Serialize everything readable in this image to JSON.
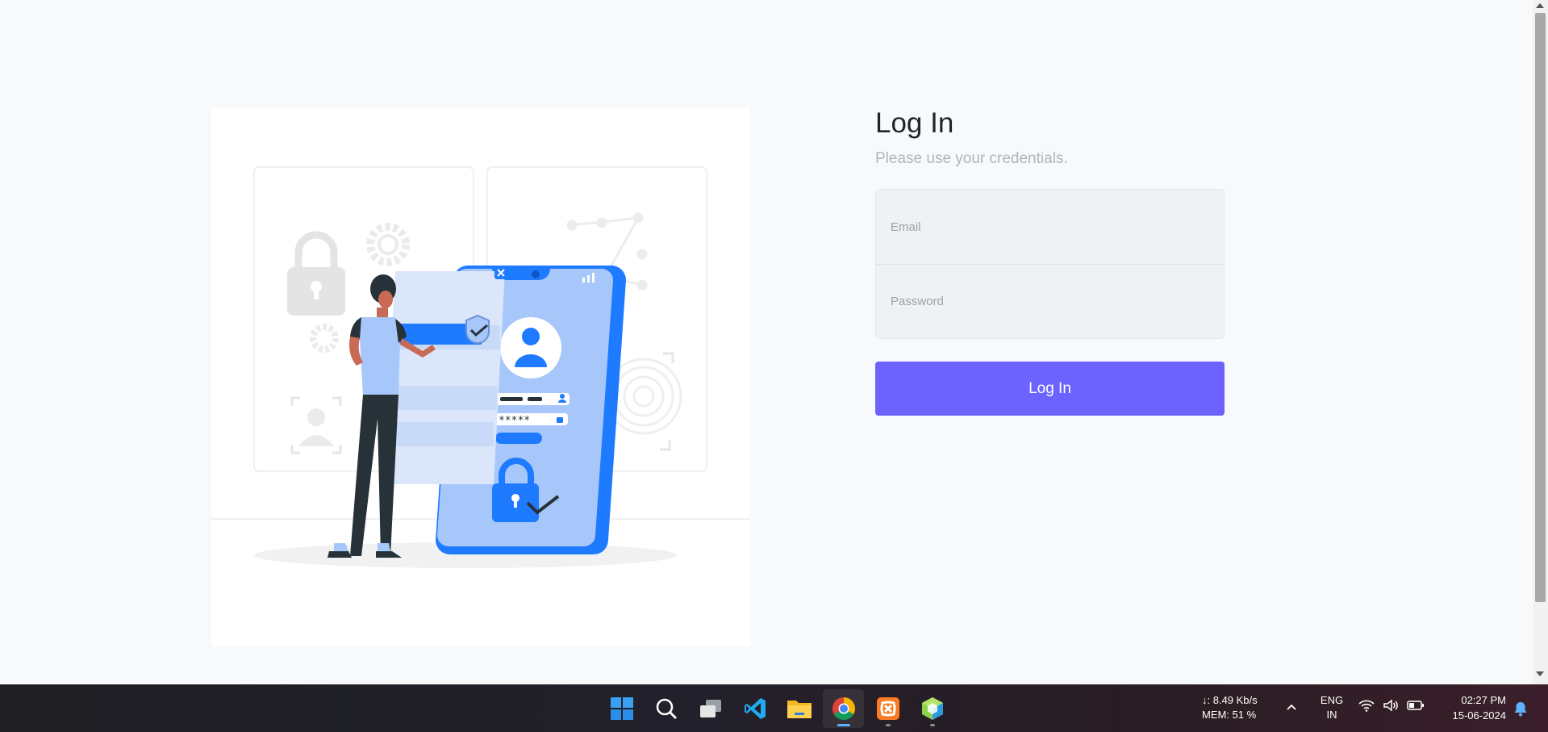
{
  "login": {
    "title": "Log In",
    "subtitle": "Please use your credentials.",
    "email_placeholder": "Email",
    "password_placeholder": "Password",
    "button_label": "Log In",
    "accent_color": "#6c63ff"
  },
  "illustration": {
    "password_mask": "*****"
  },
  "taskbar": {
    "apps": [
      {
        "name": "start-icon"
      },
      {
        "name": "search-icon"
      },
      {
        "name": "task-view-icon"
      },
      {
        "name": "vscode-icon"
      },
      {
        "name": "file-explorer-icon"
      },
      {
        "name": "chrome-icon",
        "active": true
      },
      {
        "name": "xampp-icon"
      },
      {
        "name": "app-cube-icon"
      }
    ],
    "network_speed": "↓: 8.49 Kb/s",
    "memory": "MEM: 51 %",
    "language_line1": "ENG",
    "language_line2": "IN",
    "time": "02:27 PM",
    "date": "15-06-2024"
  }
}
